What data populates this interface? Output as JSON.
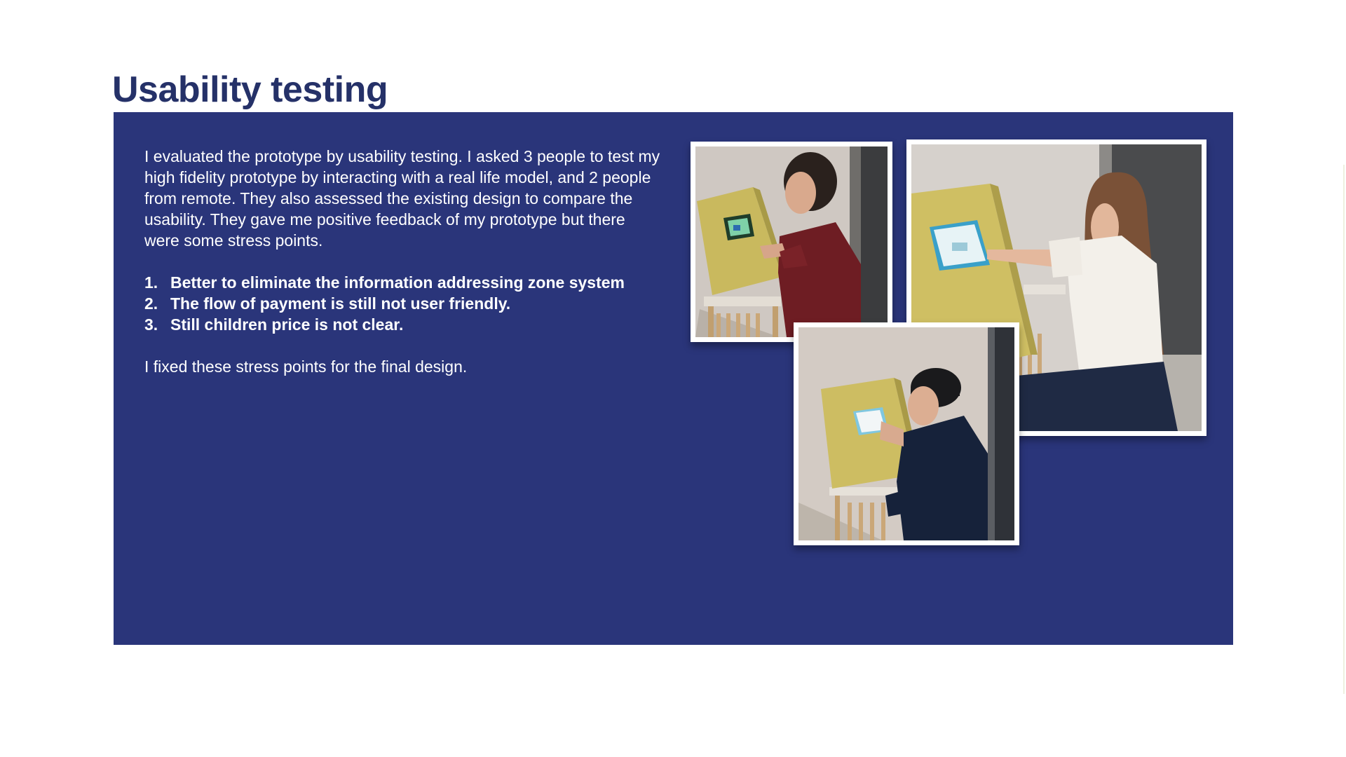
{
  "title": "Usability testing",
  "intro": "I evaluated the prototype by usability testing. I asked 3 people to test my high fidelity prototype by interacting with a real life model, and 2 people from remote. They  also assessed the existing design to compare the usability. They gave me positive feedback of my prototype but there were some stress points.",
  "findings": [
    {
      "num": "1.",
      "text": "Better to eliminate the information addressing zone system"
    },
    {
      "num": "2.",
      "text": "The flow of payment is still not user friendly."
    },
    {
      "num": "3.",
      "text": "Still children price is not clear."
    }
  ],
  "conclusion": "I fixed these stress points for the final design.",
  "colors": {
    "title": "#253168",
    "panel": "#2a357a",
    "text": "#ffffff"
  }
}
